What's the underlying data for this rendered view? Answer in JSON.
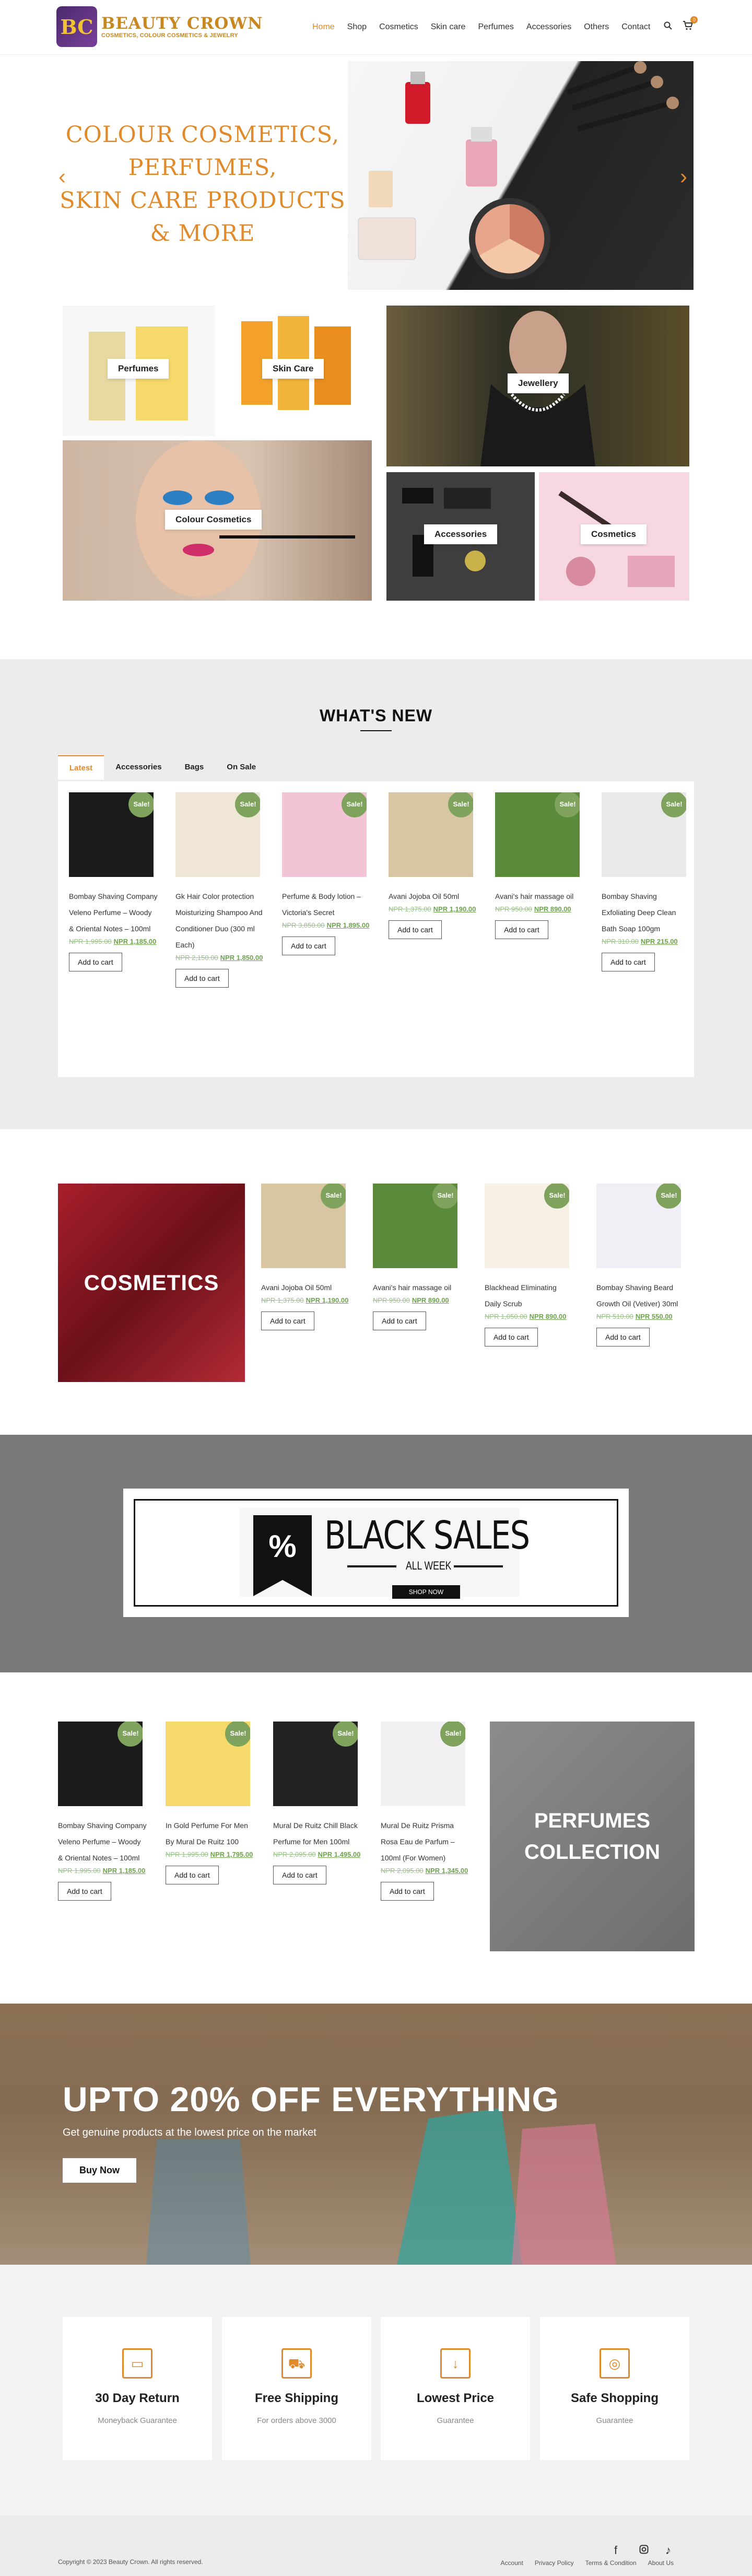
{
  "brand": {
    "name": "BEAUTY CROWN",
    "tagline": "COSMETICS, COLOUR COSMETICS & JEWELRY",
    "mark": "BC"
  },
  "nav": {
    "items": [
      "Home",
      "Shop",
      "Cosmetics",
      "Skin care",
      "Perfumes",
      "Accessories",
      "Others",
      "Contact"
    ],
    "search_icon": "search-icon",
    "cart_count": "0"
  },
  "hero": {
    "text_lines": [
      "COLOUR COSMETICS, PERFUMES,",
      "SKIN CARE PRODUCTS",
      "& MORE"
    ],
    "prev": "‹",
    "next": "›"
  },
  "categories": [
    "Perfumes",
    "Skin Care",
    "Jewellery",
    "Colour Cosmetics",
    "Accessories",
    "Cosmetics"
  ],
  "whats_new": {
    "title": "WHAT'S NEW",
    "tabs": [
      "Latest",
      "Accessories",
      "Bags",
      "On Sale"
    ],
    "products": [
      {
        "name": "Bombay Shaving Company Veleno Perfume – Woody & Oriental Notes – 100ml",
        "old": "NPR 1,995.00",
        "new": "NPR 1,185.00",
        "badge": "Sale!",
        "cta": "Add to cart"
      },
      {
        "name": "Gk Hair Color protection Moisturizing Shampoo And Conditioner Duo (300 ml Each)",
        "old": "NPR 2,150.00",
        "new": "NPR 1,850.00",
        "badge": "Sale!",
        "cta": "Add to cart"
      },
      {
        "name": "Perfume & Body lotion – Victoria's Secret",
        "old": "NPR 3,850.00",
        "new": "NPR 1,895.00",
        "badge": "Sale!",
        "cta": "Add to cart"
      },
      {
        "name": "Avani Jojoba Oil 50ml",
        "old": "NPR 1,375.00",
        "new": "NPR 1,190.00",
        "badge": "Sale!",
        "cta": "Add to cart"
      },
      {
        "name": "Avani's hair massage oil",
        "old": "NPR 950.00",
        "new": "NPR 890.00",
        "badge": "Sale!",
        "cta": "Add to cart"
      },
      {
        "name": "Bombay Shaving Exfoliating Deep Clean Bath Soap 100gm",
        "old": "NPR 310.00",
        "new": "NPR 215.00",
        "badge": "Sale!",
        "cta": "Add to cart"
      }
    ]
  },
  "cosmetics": {
    "banner": "COSMETICS",
    "products": [
      {
        "name": "Avani Jojoba Oil 50ml",
        "old": "NPR 1,375.00",
        "new": "NPR 1,190.00",
        "badge": "Sale!",
        "cta": "Add to cart"
      },
      {
        "name": "Avani's hair massage oil",
        "old": "NPR 950.00",
        "new": "NPR 890.00",
        "badge": "Sale!",
        "cta": "Add to cart"
      },
      {
        "name": "Blackhead Eliminating Daily Scrub",
        "old": "NPR 1,050.00",
        "new": "NPR 890.00",
        "badge": "Sale!",
        "cta": "Add to cart"
      },
      {
        "name": "Bombay Shaving Beard Growth Oil (Vetiver) 30ml",
        "old": "NPR 510.00",
        "new": "NPR 550.00",
        "badge": "Sale!",
        "cta": "Add to cart"
      }
    ]
  },
  "black_sales": {
    "percent": "%",
    "title": "BLACK SALES",
    "week": "ALL WEEK",
    "cta": "SHOP NOW"
  },
  "perfumes": {
    "banner_lines": [
      "PERFUMES",
      "COLLECTION"
    ],
    "products": [
      {
        "name": "Bombay Shaving Company Veleno Perfume – Woody & Oriental Notes – 100ml",
        "old": "NPR 1,995.00",
        "new": "NPR 1,185.00",
        "badge": "Sale!",
        "cta": "Add to cart"
      },
      {
        "name": "In Gold Perfume For Men By Mural De Ruitz 100",
        "old": "NPR 1,995.00",
        "new": "NPR 1,795.00",
        "badge": "Sale!",
        "cta": "Add to cart"
      },
      {
        "name": "Mural De Ruitz Chill Black Perfume for Men 100ml",
        "old": "NPR 2,095.00",
        "new": "NPR 1,495.00",
        "badge": "Sale!",
        "cta": "Add to cart"
      },
      {
        "name": "Mural De Ruitz Prisma Rosa Eau de Parfum – 100ml (For Women)",
        "old": "NPR 2,095.00",
        "new": "NPR 1,345.00",
        "badge": "Sale!",
        "cta": "Add to cart"
      }
    ]
  },
  "promo": {
    "title": "UPTO 20% OFF EVERYTHING",
    "subtitle": "Get genuine products at the lowest price on the market",
    "cta": "Buy Now"
  },
  "features": [
    {
      "icon": "wallet-icon",
      "glyph": "▭",
      "title": "30 Day Return",
      "sub": "Moneyback Guarantee"
    },
    {
      "icon": "truck-icon",
      "glyph": "⛟",
      "title": "Free Shipping",
      "sub": "For orders above 3000"
    },
    {
      "icon": "price-down-icon",
      "glyph": "↓",
      "title": "Lowest Price",
      "sub": "Guarantee"
    },
    {
      "icon": "support-icon",
      "glyph": "◎",
      "title": "Safe Shopping",
      "sub": "Guarantee"
    }
  ],
  "footer": {
    "copyright": "Copyright © 2023 Beauty Crown. All rights reserved.",
    "links": [
      "Account",
      "Privacy Policy",
      "Terms & Condition",
      "About Us"
    ],
    "social": [
      "facebook-icon",
      "instagram-icon",
      "tiktok-icon"
    ]
  },
  "colors": {
    "accent": "#e08a2b",
    "sale": "#7fa35d",
    "price": "#6ea44e"
  }
}
